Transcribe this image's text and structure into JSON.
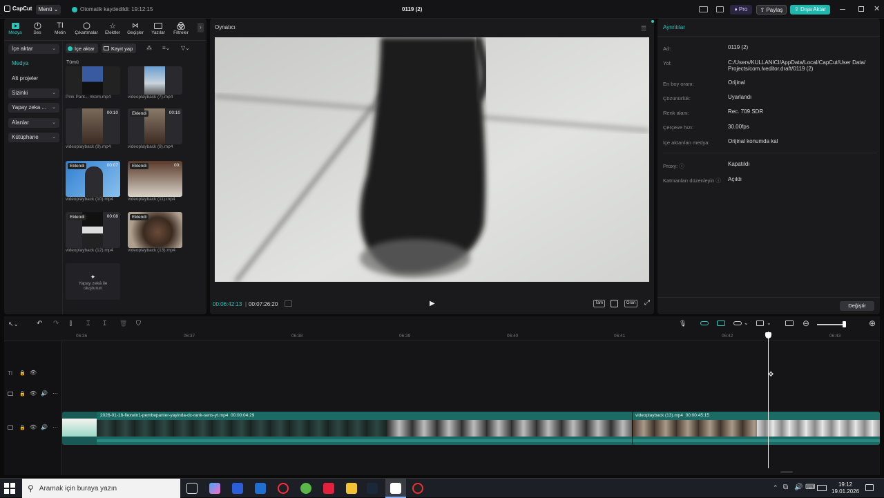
{
  "titlebar": {
    "app_logo": "CapCut",
    "menu_label": "Menü",
    "autosave_text": "Otomatik kaydedildi: 19:12:15",
    "project_title": "0119 (2)",
    "pro_label": "Pro",
    "share_label": "Paylaş",
    "export_label": "Dışa Aktar"
  },
  "tools": [
    {
      "label": "Medya",
      "icon": "media-icon"
    },
    {
      "label": "Ses",
      "icon": "audio-icon"
    },
    {
      "label": "Metin",
      "icon": "text-icon"
    },
    {
      "label": "Çıkartmalar",
      "icon": "sticker-icon"
    },
    {
      "label": "Efektler",
      "icon": "effects-icon"
    },
    {
      "label": "Geçişler",
      "icon": "transitions-icon"
    },
    {
      "label": "Yazılar",
      "icon": "captions-icon"
    },
    {
      "label": "Filtreler",
      "icon": "filters-icon"
    }
  ],
  "side_nav": [
    {
      "label": "İçe aktar",
      "chevron": true
    },
    {
      "label": "Medya",
      "chevron": false
    },
    {
      "label": "Alt projeler",
      "chevron": false
    },
    {
      "label": "Sizinki",
      "chevron": true
    },
    {
      "label": "Yapay zeka ...",
      "chevron": true
    },
    {
      "label": "Alanlar",
      "chevron": true
    },
    {
      "label": "Kütüphane",
      "chevron": true
    }
  ],
  "media_toolbar": {
    "import_label": "İçe aktar",
    "record_label": "Kayıt yap",
    "all_label": "Tümü"
  },
  "media_items": [
    {
      "name": "Pink Pant... #kom.mp4",
      "badge": "",
      "duration": ""
    },
    {
      "name": "videoplayback (7).mp4",
      "badge": "",
      "duration": ""
    },
    {
      "name": "videoplayback (9).mp4",
      "badge": "",
      "duration": "00:10"
    },
    {
      "name": "videoplayback (8).mp4",
      "badge": "Eklendi",
      "duration": "00:10"
    },
    {
      "name": "videoplayback (10).mp4",
      "badge": "Eklendi",
      "duration": "00:07"
    },
    {
      "name": "videoplayback (11).mp4",
      "badge": "Eklendi",
      "duration": "00:"
    },
    {
      "name": "videoplayback (12).mp4",
      "badge": "Eklendi",
      "duration": "00:08"
    },
    {
      "name": "videoplayback (13).mp4",
      "badge": "Eklendi",
      "duration": ""
    }
  ],
  "ai_create": {
    "line1": "Yapay zekâ ile",
    "line2": "oluşturun"
  },
  "player": {
    "title": "Oynatıcı",
    "current_time": "00:06:42:13",
    "total_time": "00:07:26:20",
    "full_label": "Tam",
    "ratio_label": "Oran"
  },
  "details": {
    "title": "Ayrıntılar",
    "rows": [
      {
        "label": "Ad:",
        "value": "0119 (2)"
      },
      {
        "label": "Yol:",
        "value": "C:/Users/KULLANICI/AppData/Local/CapCut/User Data/"
      },
      {
        "label": "",
        "value": "Projects/com.lveditor.draft/0119 (2)"
      },
      {
        "label": "En boy oranı:",
        "value": "Orijinal"
      },
      {
        "label": "Çözünürlük:",
        "value": "Uyarlandı"
      },
      {
        "label": "Renk alanı:",
        "value": "Rec. 709 SDR"
      },
      {
        "label": "Çerçeve hızı:",
        "value": "30.00fps"
      },
      {
        "label": "İçe aktarılan medya:",
        "value": "Orijinal konumda kal"
      },
      {
        "label": "Proxy:",
        "value": "Kapatıldı"
      },
      {
        "label": "Katmanları düzenleyin",
        "value": "Açıldı"
      }
    ],
    "change_label": "Değiştir"
  },
  "timeline": {
    "ruler": [
      "06:36",
      "06:37",
      "06:38",
      "06:39",
      "06:40",
      "06:41",
      "06:42",
      "06:43"
    ],
    "clip1_name": "2026-01-18-flexwin1-pembepanter-yayinda-dc-rank-sens-yt.mp4",
    "clip1_duration": "00:00:04:29",
    "clip2_name": "videoplayback (13).mp4",
    "clip2_duration": "00:00:45:15"
  },
  "taskbar": {
    "search_placeholder": "Aramak için buraya yazın",
    "time": "19:12",
    "date": "19.01.2026"
  },
  "colors": {
    "accent": "#27c9bd",
    "clip_teal": "#1f6f6a",
    "export_bg": "#1fb8ac"
  }
}
